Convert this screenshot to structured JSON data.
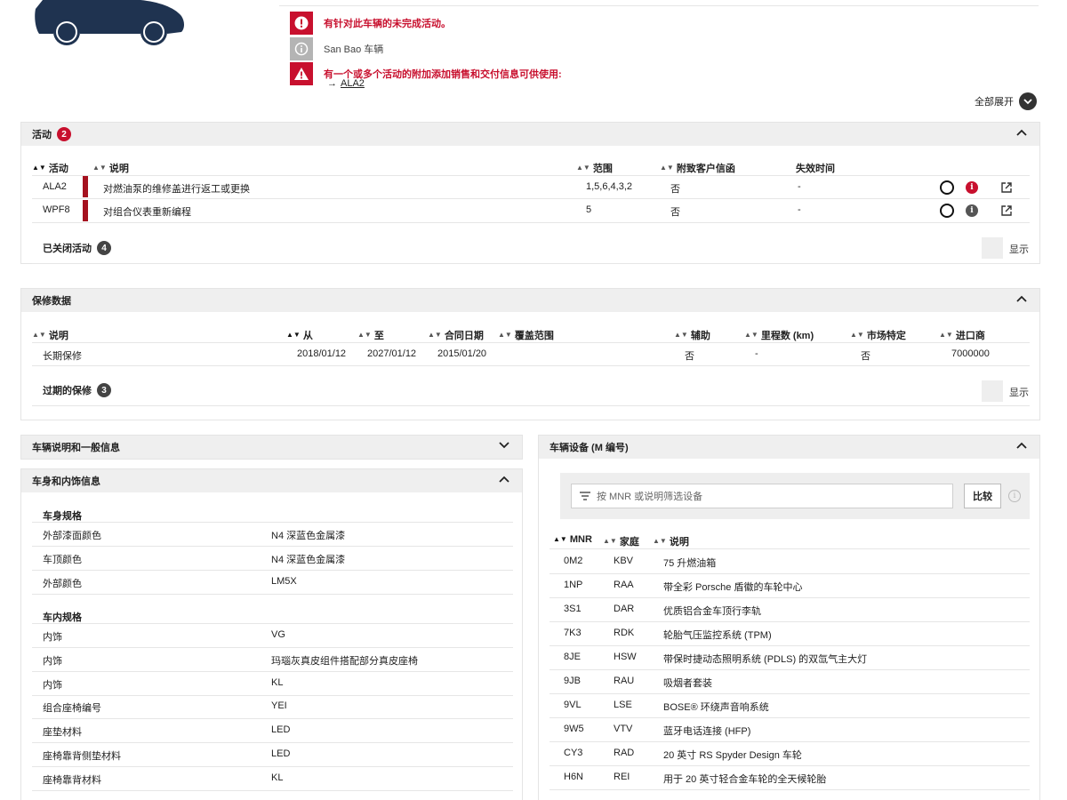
{
  "alerts": {
    "open_campaign": "有针对此车辆的未完成活动。",
    "dealer": "San Bao 车辆",
    "additional": "有一个或多个活动的附加添加销售和交付信息可供使用:",
    "link_label": "ALA2"
  },
  "expand_all": "全部展开",
  "campaigns": {
    "title": "活动",
    "count": "2",
    "headers": [
      "活动",
      "说明",
      "范围",
      "附致客户信函",
      "失效时间"
    ],
    "rows": [
      {
        "code": "ALA2",
        "desc": "对燃油泵的维修盖进行返工或更换",
        "scope": "1,5,6,4,3,2",
        "letter": "否",
        "expiry": "-",
        "info_color": "#c8102e"
      },
      {
        "code": "WPF8",
        "desc": "对组合仪表重新编程",
        "scope": "5",
        "letter": "否",
        "expiry": "-",
        "info_color": "#555555"
      }
    ],
    "closed_label": "已关闭活动",
    "closed_count": "4",
    "show_label": "显示"
  },
  "warranty": {
    "title": "保修数据",
    "headers": [
      "说明",
      "从",
      "至",
      "合同日期",
      "覆盖范围",
      "辅助",
      "里程数 (km)",
      "市场特定",
      "进口商"
    ],
    "rows": [
      {
        "desc": "长期保修",
        "from": "2018/01/12",
        "to": "2027/01/12",
        "contract": "2015/01/20",
        "coverage": "",
        "aux": "否",
        "mileage": "-",
        "market": "否",
        "importer": "7000000"
      }
    ],
    "expired_label": "过期的保修",
    "expired_count": "3",
    "show_label": "显示"
  },
  "vehicle_info": {
    "title": "车辆说明和一般信息"
  },
  "body_interior": {
    "title": "车身和内饰信息",
    "body_group": "车身规格",
    "body_rows": [
      {
        "label": "外部漆面颜色",
        "value": "N4 深蓝色金属漆"
      },
      {
        "label": "车顶颜色",
        "value": "N4 深蓝色金属漆"
      },
      {
        "label": "外部颜色",
        "value": "LM5X"
      }
    ],
    "interior_group": "车内规格",
    "interior_rows": [
      {
        "label": "内饰",
        "value": "VG"
      },
      {
        "label": "内饰",
        "value": "玛瑙灰真皮组件搭配部分真皮座椅"
      },
      {
        "label": "内饰",
        "value": "KL"
      },
      {
        "label": "组合座椅编号",
        "value": "YEI"
      },
      {
        "label": "座垫材料",
        "value": "LED"
      },
      {
        "label": "座椅靠背侧垫材料",
        "value": "LED"
      },
      {
        "label": "座椅靠背材料",
        "value": "KL"
      }
    ]
  },
  "equipment": {
    "title": "车辆设备 (M 编号)",
    "filter_placeholder": "按 MNR 或说明筛选设备",
    "compare_label": "比较",
    "headers": [
      "MNR",
      "家庭",
      "说明"
    ],
    "rows": [
      {
        "mnr": "0M2",
        "family": "KBV",
        "desc": "75 升燃油箱"
      },
      {
        "mnr": "1NP",
        "family": "RAA",
        "desc": "带全彩 Porsche 盾徽的车轮中心"
      },
      {
        "mnr": "3S1",
        "family": "DAR",
        "desc": "优质铝合金车顶行李轨"
      },
      {
        "mnr": "7K3",
        "family": "RDK",
        "desc": "轮胎气压监控系统 (TPM)"
      },
      {
        "mnr": "8JE",
        "family": "HSW",
        "desc": "带保时捷动态照明系统 (PDLS) 的双氙气主大灯"
      },
      {
        "mnr": "9JB",
        "family": "RAU",
        "desc": "吸烟者套装"
      },
      {
        "mnr": "9VL",
        "family": "LSE",
        "desc": "BOSE® 环绕声音响系统"
      },
      {
        "mnr": "9W5",
        "family": "VTV",
        "desc": "蓝牙电话连接 (HFP)"
      },
      {
        "mnr": "CY3",
        "family": "RAD",
        "desc": "20 英寸 RS Spyder Design 车轮"
      },
      {
        "mnr": "H6N",
        "family": "REI",
        "desc": "用于 20 英寸轻合金车轮的全天候轮胎"
      }
    ]
  },
  "colors": {
    "accent_red": "#c8102e",
    "car_blue": "#1f3350"
  }
}
